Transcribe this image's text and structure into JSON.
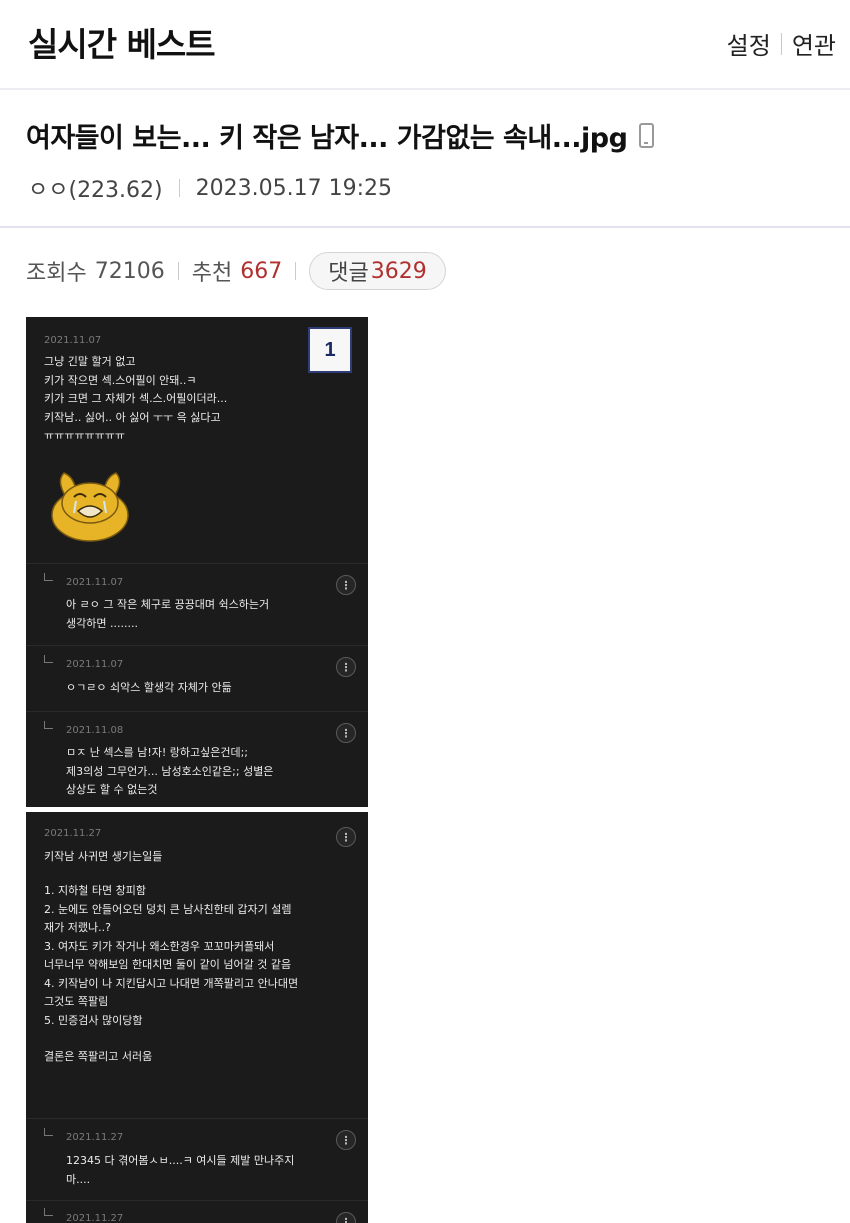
{
  "header": {
    "brand": "실시간 베스트",
    "settings_label": "설정",
    "related_label": "연관"
  },
  "post": {
    "title": "여자들이 보는... 키 작은 남자... 가감없는 속내...jpg",
    "author": "ㅇㅇ(223.62)",
    "datetime": "2023.05.17 19:25",
    "mobile_icon": "mobile-phone-icon"
  },
  "stats": {
    "views_label": "조회수",
    "views": "72106",
    "recommend_label": "추천",
    "recommend": "667",
    "comments_label": "댓글",
    "comments": "3629"
  },
  "image1": {
    "badge": "1",
    "post_date": "2021.11.07",
    "post_text": "그냥 긴말 할거 없고\n키가 작으면 섹.스어필이 안돼..ㅋ\n키가 크면 그 자체가 섹.스.어필이더라...\n키작남.. 싫어.. 아 싫어 ㅜㅜ 윽 싫다고\nㅠㅠㅠㅠㅠㅠㅠㅠ",
    "sticker_icon": "crying-cartoon-sticker-icon",
    "replies": [
      {
        "date": "2021.11.07",
        "text": "아 ㄹㅇ 그 작은 체구로 끙끙대며 쉭스하는거\n생각하면 ........"
      },
      {
        "date": "2021.11.07",
        "text": "ㅇㄱㄹㅇ 쇠악스 할생각 자체가 안듦"
      },
      {
        "date": "2021.11.08",
        "text": "ㅁㅈ 난 섹스를 남!자! 랑하고싶은건데;;\n제3의성 그무언가... 남성호소인같은;; 성별은\n상상도 할 수 없는것"
      }
    ]
  },
  "image2": {
    "post_date": "2021.11.27",
    "post_text": "키작남 사귀면 생기는일들",
    "list_text": "1. 지하철 타면 창피함\n2. 눈에도 안들어오던 덩치 큰 남사친한테 갑자기 설렘\n재가 저랬나..?\n3. 여자도 키가 작거나 왜소한경우 꼬꼬마커플돼서\n너무너무 약해보임 한대치면 둘이 같이 넘어갈 것 같음\n4. 키작남이 나 지킨답시고 나대면 개쪽팔리고 안나대면\n그것도 쪽팔림\n5. 민증검사 많이당함",
    "conclusion": "결론은 쪽팔리고 서러움",
    "replies": [
      {
        "date": "2021.11.27",
        "text": "12345 다 겪어봄ㅅㅂ....ㅋ 여시들 제발 만나주지\n마...."
      },
      {
        "date": "2021.11.27",
        "text": ""
      }
    ]
  },
  "colors": {
    "accent_red": "#b03030",
    "badge_border": "#2e3d78",
    "screenshot_bg": "#1b1b1b"
  }
}
